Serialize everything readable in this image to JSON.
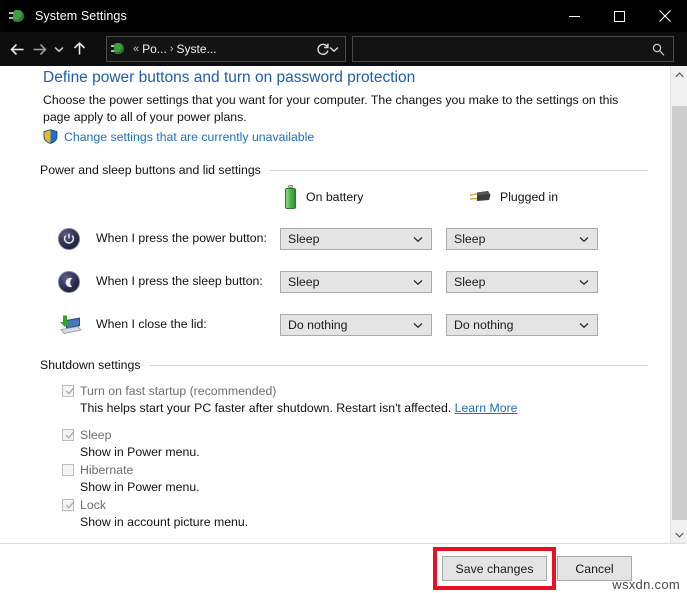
{
  "window": {
    "title": "System Settings",
    "title_icon": "power-plug-icon",
    "controls": {
      "minimize": "minimize-icon",
      "maximize": "maximize-icon",
      "close": "close-icon"
    }
  },
  "navbar": {
    "back": "back-arrow-icon",
    "forward": "forward-arrow-icon",
    "recent": "chevron-down-icon",
    "up": "up-arrow-icon",
    "refresh": "refresh-icon",
    "breadcrumb": {
      "icon": "power-plug-icon",
      "overflow": "«",
      "items": [
        "Po...",
        "Syste..."
      ],
      "separator": "›",
      "dropdown": "chevron-down-icon"
    },
    "search": {
      "value": "",
      "placeholder": "",
      "icon": "search-icon"
    }
  },
  "page": {
    "title": "Define power buttons and turn on password protection",
    "description": "Choose the power settings that you want for your computer. The changes you make to the settings on this page apply to all of your power plans.",
    "uac_link": "Change settings that are currently unavailable",
    "uac_icon": "shield-icon"
  },
  "power_section": {
    "heading": "Power and sleep buttons and lid settings",
    "columns": [
      {
        "label": "On battery",
        "icon": "battery-icon"
      },
      {
        "label": "Plugged in",
        "icon": "power-plug-icon"
      }
    ],
    "rows": [
      {
        "icon": "power-button-icon",
        "label": "When I press the power button:",
        "on_battery": "Sleep",
        "plugged_in": "Sleep"
      },
      {
        "icon": "sleep-moon-icon",
        "label": "When I press the sleep button:",
        "on_battery": "Sleep",
        "plugged_in": "Sleep"
      },
      {
        "icon": "laptop-lid-icon",
        "label": "When I close the lid:",
        "on_battery": "Do nothing",
        "plugged_in": "Do nothing"
      }
    ]
  },
  "shutdown_section": {
    "heading": "Shutdown settings",
    "items": [
      {
        "label": "Turn on fast startup (recommended)",
        "checked": true,
        "description": "This helps start your PC faster after shutdown. Restart isn't affected.",
        "link": "Learn More"
      },
      {
        "label": "Sleep",
        "checked": true,
        "description": "Show in Power menu.",
        "link": ""
      },
      {
        "label": "Hibernate",
        "checked": false,
        "description": "Show in Power menu.",
        "link": ""
      },
      {
        "label": "Lock",
        "checked": true,
        "description": "Show in account picture menu.",
        "link": ""
      }
    ]
  },
  "footer": {
    "save_label": "Save changes",
    "cancel_label": "Cancel",
    "highlight_color": "#e81123",
    "watermark": "wsxdn.com"
  }
}
